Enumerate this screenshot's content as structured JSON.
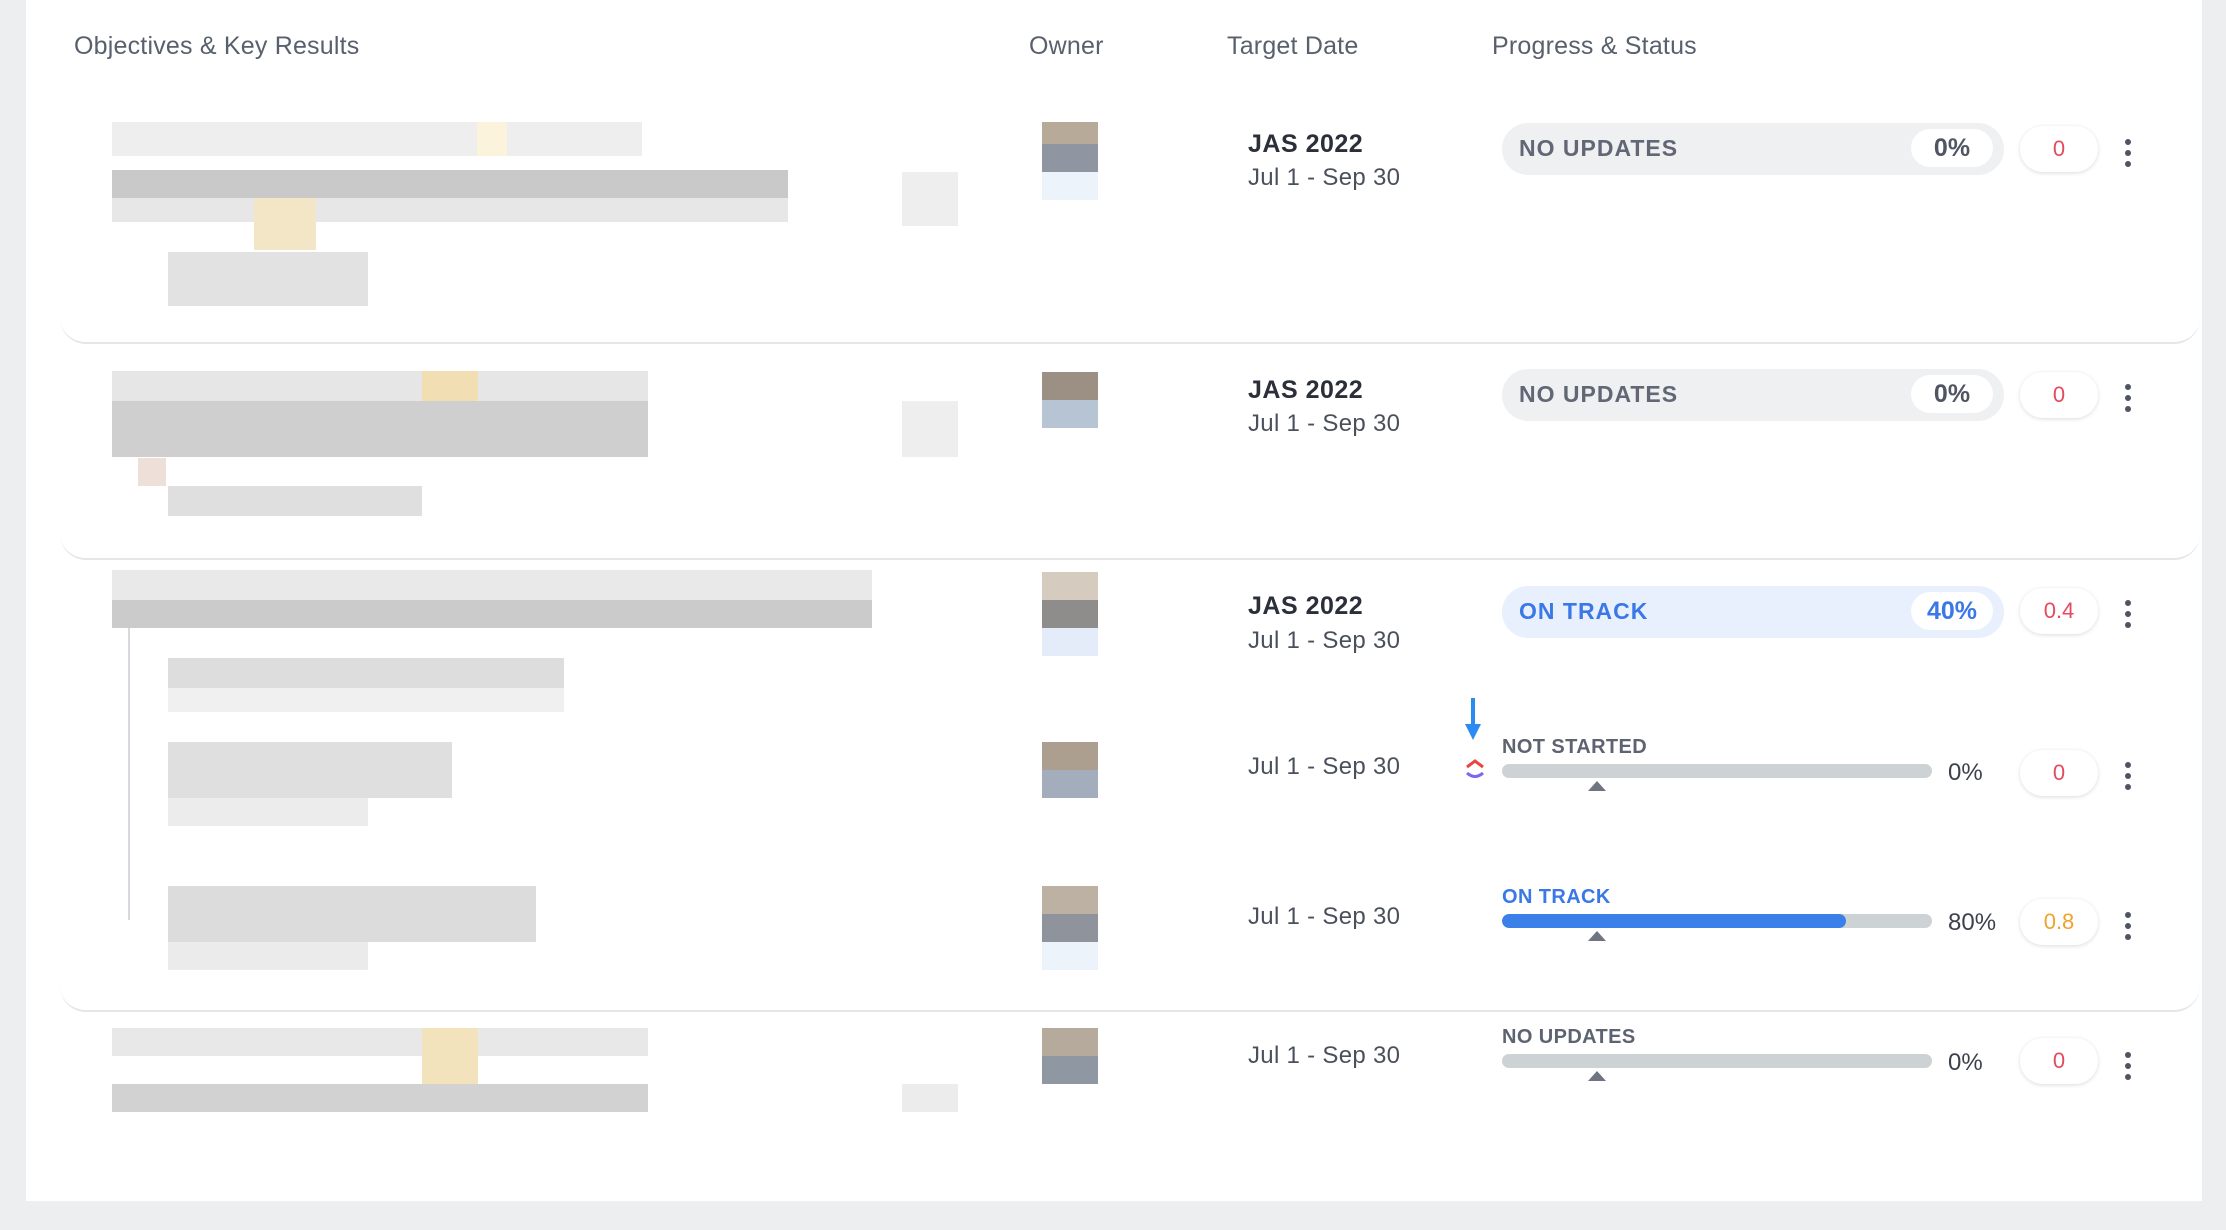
{
  "columns": {
    "objectives": "Objectives & Key Results",
    "owner": "Owner",
    "target_date": "Target Date",
    "progress": "Progress & Status"
  },
  "colors": {
    "accent_blue": "#3b78e7",
    "score_red": "#e34b5f",
    "score_orange": "#f0a32b",
    "pill_grey": "#eff0f2",
    "pill_blue": "#e8effd"
  },
  "rows": [
    {
      "kind": "objective",
      "quarter": "JAS 2022",
      "range": "Jul 1 - Sep 30",
      "status": "NO UPDATES",
      "percent": "0%",
      "progress": 0,
      "score": "0"
    },
    {
      "kind": "objective",
      "quarter": "JAS 2022",
      "range": "Jul 1 - Sep 30",
      "status": "NO UPDATES",
      "percent": "0%",
      "progress": 0,
      "score": "0"
    },
    {
      "kind": "objective",
      "quarter": "JAS 2022",
      "range": "Jul 1 - Sep 30",
      "status": "ON TRACK",
      "percent": "40%",
      "progress": 0.4,
      "score": "0.4",
      "expanded": true
    },
    {
      "kind": "key_result",
      "range": "Jul 1 - Sep 30",
      "status": "NOT STARTED",
      "percent": "0%",
      "progress": 0,
      "score": "0",
      "icon": "clickup-logo-icon",
      "annotation": "arrow-down-icon"
    },
    {
      "kind": "key_result",
      "range": "Jul 1 - Sep 30",
      "status": "ON TRACK",
      "percent": "80%",
      "progress": 0.8,
      "score": "0.8"
    },
    {
      "kind": "key_result",
      "range": "Jul 1 - Sep 30",
      "status": "NO UPDATES",
      "percent": "0%",
      "progress": 0,
      "score": "0"
    }
  ]
}
